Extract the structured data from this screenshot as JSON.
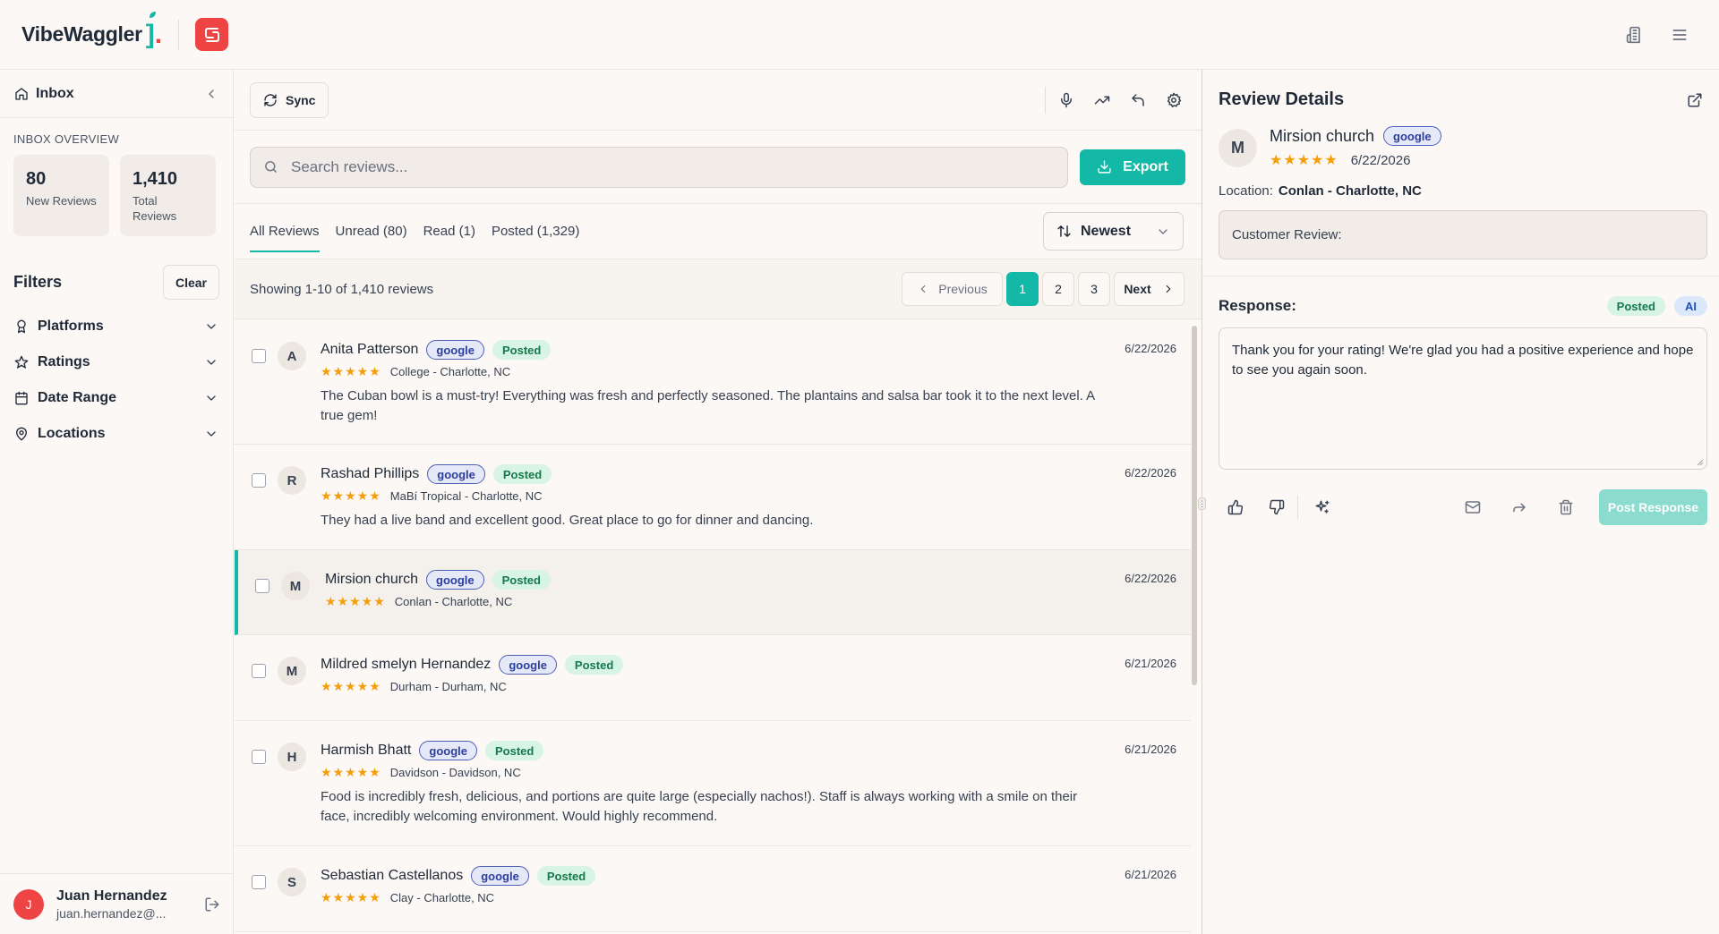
{
  "brand": {
    "name": "VibeWaggler",
    "bracket": "].",
    "logo_icon": "app-logo-icon"
  },
  "topbar": {
    "icons": [
      "building-icon",
      "menu-icon"
    ]
  },
  "sidebar": {
    "inbox_label": "Inbox",
    "overview_title": "INBOX OVERVIEW",
    "stats": [
      {
        "value": "80",
        "caption": "New Reviews"
      },
      {
        "value": "1,410",
        "caption": "Total Reviews"
      }
    ],
    "filters_title": "Filters",
    "clear_label": "Clear",
    "filters": [
      {
        "label": "Platforms",
        "icon": "award-icon"
      },
      {
        "label": "Ratings",
        "icon": "star-icon"
      },
      {
        "label": "Date Range",
        "icon": "calendar-icon"
      },
      {
        "label": "Locations",
        "icon": "map-pin-icon"
      }
    ]
  },
  "user": {
    "initial": "J",
    "name": "Juan Hernandez",
    "email": "juan.hernandez@..."
  },
  "toolbar": {
    "sync_label": "Sync",
    "icons": [
      "mic-icon",
      "trending-up-icon",
      "undo-icon",
      "settings-icon"
    ]
  },
  "search": {
    "placeholder": "Search reviews...",
    "value": ""
  },
  "export_label": "Export",
  "tabs": [
    {
      "label": "All Reviews",
      "active": true
    },
    {
      "label": "Unread (80)",
      "active": false
    },
    {
      "label": "Read (1)",
      "active": false
    },
    {
      "label": "Posted (1,329)",
      "active": false
    }
  ],
  "sort": {
    "selected": "Newest"
  },
  "pagination": {
    "showing": "Showing 1-10 of 1,410 reviews",
    "prev_label": "Previous",
    "pages": [
      "1",
      "2",
      "3"
    ],
    "current_page": "1",
    "next_label": "Next"
  },
  "reviews": [
    {
      "initial": "A",
      "name": "Anita Patterson",
      "platform": "google",
      "status": "Posted",
      "stars": "★★★★★",
      "location": "College - Charlotte, NC",
      "text": "The Cuban bowl is a must-try! Everything was fresh and perfectly seasoned. The plantains and salsa bar took it to the next level. A true gem!",
      "date": "6/22/2026",
      "selected": false
    },
    {
      "initial": "R",
      "name": "Rashad Phillips",
      "platform": "google",
      "status": "Posted",
      "stars": "★★★★★",
      "location": "MaBí Tropical - Charlotte, NC",
      "text": "They had a live band and excellent good. Great place to go for dinner and dancing.",
      "date": "6/22/2026",
      "selected": false
    },
    {
      "initial": "M",
      "name": "Mirsion church",
      "platform": "google",
      "status": "Posted",
      "stars": "★★★★★",
      "location": "Conlan - Charlotte, NC",
      "text": "",
      "date": "6/22/2026",
      "selected": true
    },
    {
      "initial": "M",
      "name": "Mildred smelyn Hernandez",
      "platform": "google",
      "status": "Posted",
      "stars": "★★★★★",
      "location": "Durham - Durham, NC",
      "text": "",
      "date": "6/21/2026",
      "selected": false
    },
    {
      "initial": "H",
      "name": "Harmish Bhatt",
      "platform": "google",
      "status": "Posted",
      "stars": "★★★★★",
      "location": "Davidson - Davidson, NC",
      "text": "Food is incredibly fresh, delicious, and portions are quite large (especially nachos!). Staff is always working with a smile on their face, incredibly welcoming environment. Would highly recommend.",
      "date": "6/21/2026",
      "selected": false
    },
    {
      "initial": "S",
      "name": "Sebastian Castellanos",
      "platform": "google",
      "status": "Posted",
      "stars": "★★★★★",
      "location": "Clay - Charlotte, NC",
      "text": "",
      "date": "6/21/2026",
      "selected": false
    }
  ],
  "details": {
    "title": "Review Details",
    "initial": "M",
    "name": "Mirsion church",
    "platform": "google",
    "stars": "★★★★★",
    "date": "6/22/2026",
    "location_label": "Location:",
    "location": "Conlan - Charlotte, NC",
    "customer_review_label": "Customer Review:",
    "response_label": "Response:",
    "response_status": "Posted",
    "response_source": "AI",
    "response_text": "Thank you for your rating! We're glad you had a positive experience and hope to see you again soon.",
    "post_label": "Post Response"
  },
  "colors": {
    "accent": "#14b8a6",
    "brand_red": "#ef4444",
    "star": "#f59e0b",
    "posted_bg": "#d7f4e5",
    "google_border": "#4f5fb8"
  }
}
